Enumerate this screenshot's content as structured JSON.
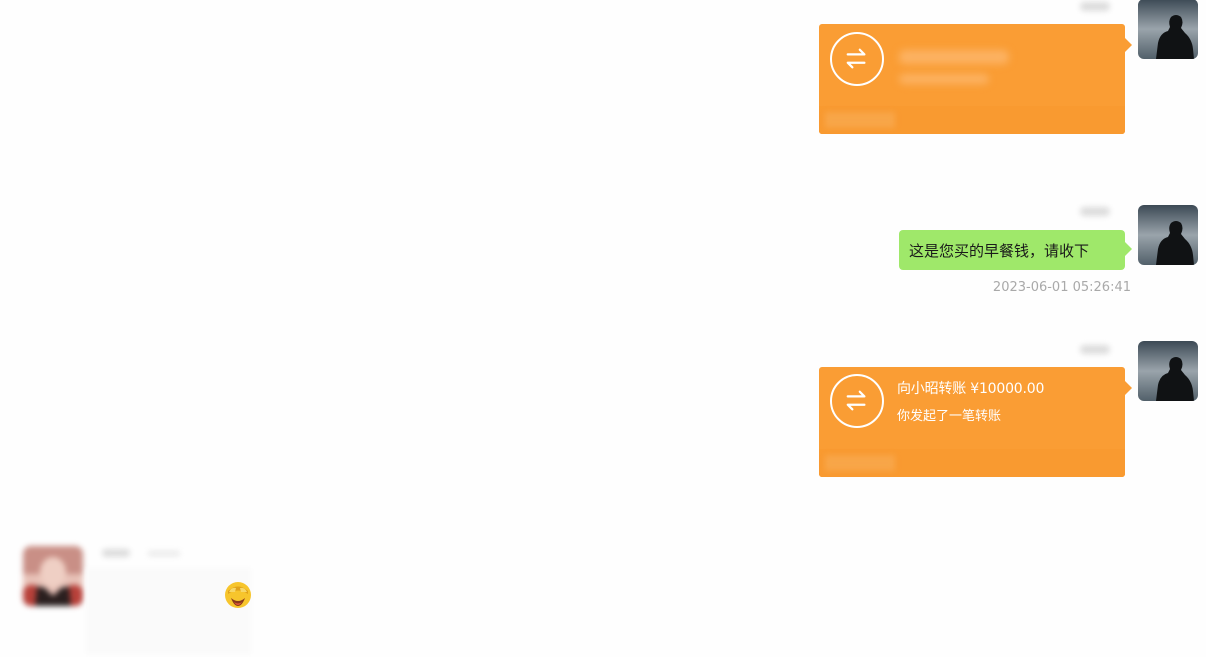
{
  "conversation": {
    "messages": [
      {
        "type": "transfer",
        "direction": "outgoing",
        "title": "",
        "subtitle": ""
      },
      {
        "type": "text",
        "direction": "outgoing",
        "text": "这是您买的早餐钱，请收下",
        "timestamp": "2023-06-01 05:26:41"
      },
      {
        "type": "transfer",
        "direction": "outgoing",
        "title": "向小昭转账 ¥10000.00",
        "subtitle": "你发起了一笔转账"
      },
      {
        "type": "emoji",
        "direction": "incoming",
        "emoji_icon": "facepalm-emoji-icon"
      }
    ]
  },
  "colors": {
    "transfer_card": "#fa9d34",
    "text_bubble": "#9fe86a",
    "timestamp": "#a9a9a9",
    "background": "#fefefe"
  },
  "icons": {
    "transfer": "transfer-arrows-icon",
    "sender_avatar": "silhouette-avatar-icon",
    "receiver_avatar": "blurred-person-avatar-icon"
  }
}
